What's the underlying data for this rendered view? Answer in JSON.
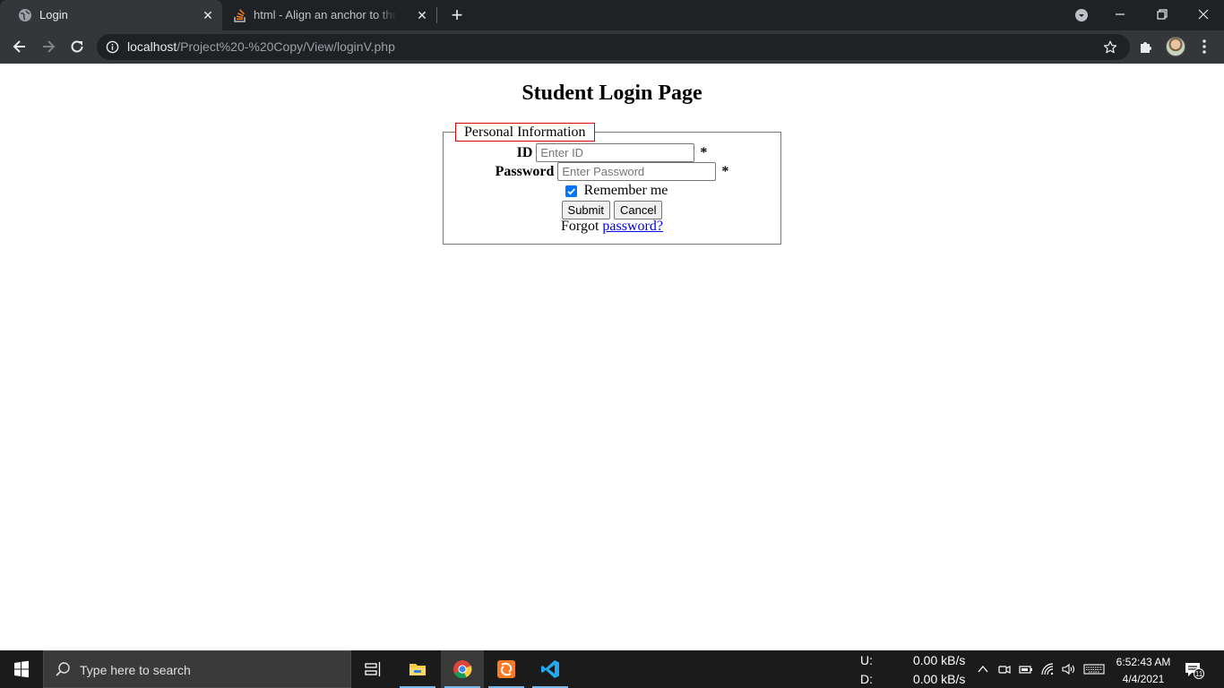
{
  "browser": {
    "tabs": [
      {
        "title": "Login",
        "active": true
      },
      {
        "title": "html - Align an anchor to the right",
        "active": false
      }
    ],
    "address": {
      "host": "localhost",
      "path": "/Project%20-%20Copy/View/loginV.php"
    }
  },
  "page": {
    "title": "Student Login Page",
    "fieldset_legend": "Personal Information",
    "id_label": "ID",
    "id_placeholder": "Enter ID",
    "password_label": "Password",
    "password_placeholder": "Enter Password",
    "required_marker": "*",
    "remember_label": "Remember me",
    "remember_checked": true,
    "submit_label": "Submit",
    "cancel_label": "Cancel",
    "forgot_text": "Forgot",
    "forgot_link": "password?",
    "colors": {
      "legend_border": "#e00000",
      "link": "#0000ee",
      "checkbox": "#0075ff"
    }
  },
  "taskbar": {
    "search_placeholder": "Type here to search",
    "apps": [
      "task-view-icon",
      "file-explorer-icon",
      "chrome-icon",
      "xampp-icon",
      "vscode-icon"
    ],
    "net_upload_label": "U:",
    "net_upload_value": "0.00 kB/s",
    "net_download_label": "D:",
    "net_download_value": "0.00 kB/s",
    "time": "6:52:43 AM",
    "date": "4/4/2021",
    "notification_count": "11"
  }
}
